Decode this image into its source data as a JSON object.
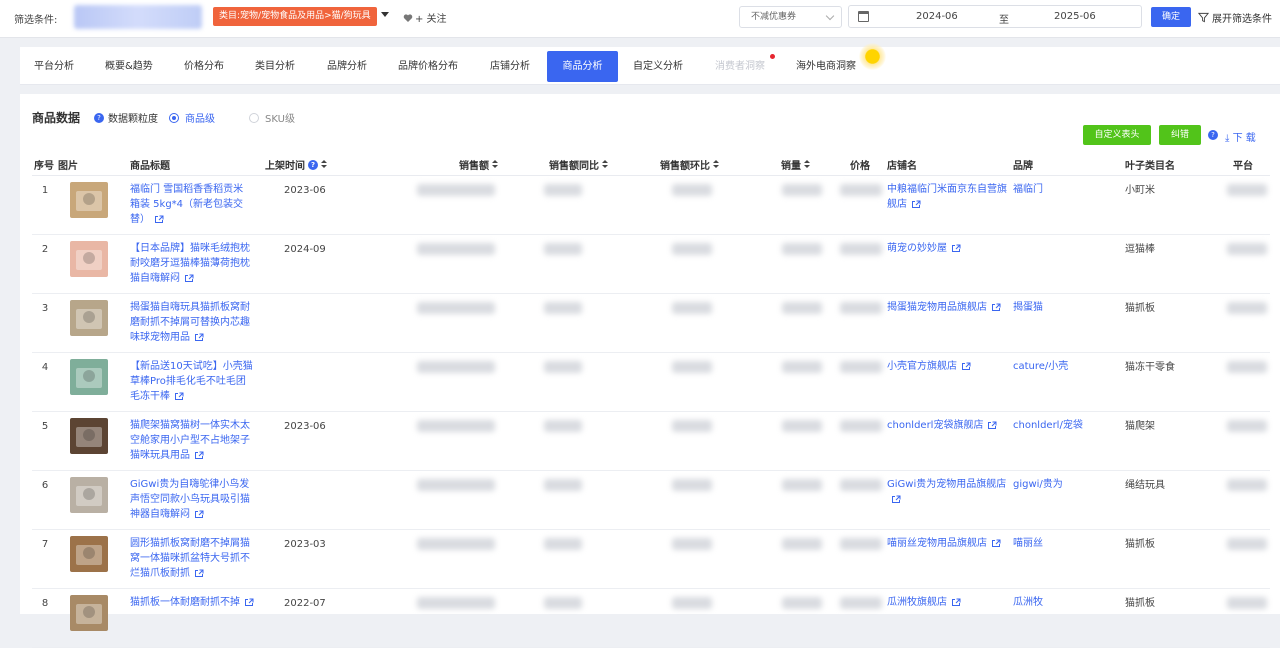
{
  "filter_bar": {
    "label": "筛选条件:",
    "category_tag": "类目:宠物/宠物食品及用品>猫/狗玩具",
    "follow_label": "+ 关注",
    "coupon_select": "不减优惠券",
    "date_start": "2024-06",
    "date_separator": "至",
    "date_end": "2025-06",
    "confirm_label": "确定",
    "expand_label": "展开筛选条件"
  },
  "tabs": [
    {
      "label": "平台分析"
    },
    {
      "label": "概要&趋势"
    },
    {
      "label": "价格分布"
    },
    {
      "label": "类目分析"
    },
    {
      "label": "品牌分析"
    },
    {
      "label": "品牌价格分布"
    },
    {
      "label": "店铺分析"
    },
    {
      "label": "商品分析"
    },
    {
      "label": "自定义分析"
    },
    {
      "label": "消费者洞察"
    },
    {
      "label": "海外电商洞察"
    }
  ],
  "active_tab": "商品分析",
  "section": {
    "title": "商品数据",
    "granularity_label": "数据颗粒度",
    "option_product": "商品级",
    "option_sku": "SKU级",
    "selected_option": "商品级",
    "custom_header_label": "自定义表头",
    "feedback_label": "纠错",
    "download_label": "下 载"
  },
  "table": {
    "columns": [
      "序号",
      "图片",
      "商品标题",
      "上架时间",
      "销售额",
      "销售额同比",
      "销售额环比",
      "销量",
      "价格",
      "店铺名",
      "品牌",
      "叶子类目名",
      "平台"
    ],
    "rows": [
      {
        "index": "1",
        "title": "福临门 雪国稻香香稻贡米 箱装 5kg*4（新老包装交替）",
        "date": "2023-06",
        "store": "中粮福临门米面京东自营旗舰店",
        "brand": "福临门",
        "leaf": "小町米"
      },
      {
        "index": "2",
        "title": "【日本品牌】猫咪毛绒抱枕耐咬磨牙逗猫棒猫薄荷抱枕猫自嗨解闷",
        "date": "2024-09",
        "store": "萌宠の妙妙屋",
        "brand": "",
        "leaf": "逗猫棒"
      },
      {
        "index": "3",
        "title": "揭蛋猫自嗨玩具猫抓板窝耐磨耐抓不掉屑可替换内芯趣味球宠物用品",
        "date": "",
        "store": "揭蛋猫宠物用品旗舰店",
        "brand": "揭蛋猫",
        "leaf": "猫抓板"
      },
      {
        "index": "4",
        "title": "【新品送10天试吃】小壳猫草棒Pro排毛化毛不吐毛团毛冻干棒",
        "date": "",
        "store": "小壳官方旗舰店",
        "brand": "cature/小壳",
        "leaf": "猫冻干零食"
      },
      {
        "index": "5",
        "title": "猫爬架猫窝猫树一体实木太空舱家用小户型不占地架子猫咪玩具用品",
        "date": "2023-06",
        "store": "chonlderl宠袋旗舰店",
        "brand": "chonlderl/宠袋",
        "leaf": "猫爬架"
      },
      {
        "index": "6",
        "title": "GiGwi贵为自嗨鸵律小鸟发声悟空同款小鸟玩具吸引猫神器自嗨解闷",
        "date": "",
        "store": "GiGwi贵为宠物用品旗舰店",
        "brand": "gigwi/贵为",
        "leaf": "绳结玩具"
      },
      {
        "index": "7",
        "title": "圆形猫抓板窝耐磨不掉屑猫窝一体猫咪抓盆特大号抓不烂猫爪板耐抓",
        "date": "2023-03",
        "store": "喵丽丝宠物用品旗舰店",
        "brand": "喵丽丝",
        "leaf": "猫抓板"
      },
      {
        "index": "8",
        "title": "猫抓板一体耐磨耐抓不掉",
        "date": "2022-07",
        "store": "瓜洲牧旗舰店",
        "brand": "瓜洲牧",
        "leaf": "猫抓板"
      }
    ]
  },
  "colors": {
    "accent": "#3a66f0",
    "tag_red": "#f0643c",
    "green_button": "#52c41a",
    "notice_dot": "#e6262f"
  },
  "icons": [
    "heart-icon",
    "calendar-icon",
    "filter-icon",
    "question-icon",
    "download-icon",
    "external-link-icon",
    "sort-icon"
  ]
}
